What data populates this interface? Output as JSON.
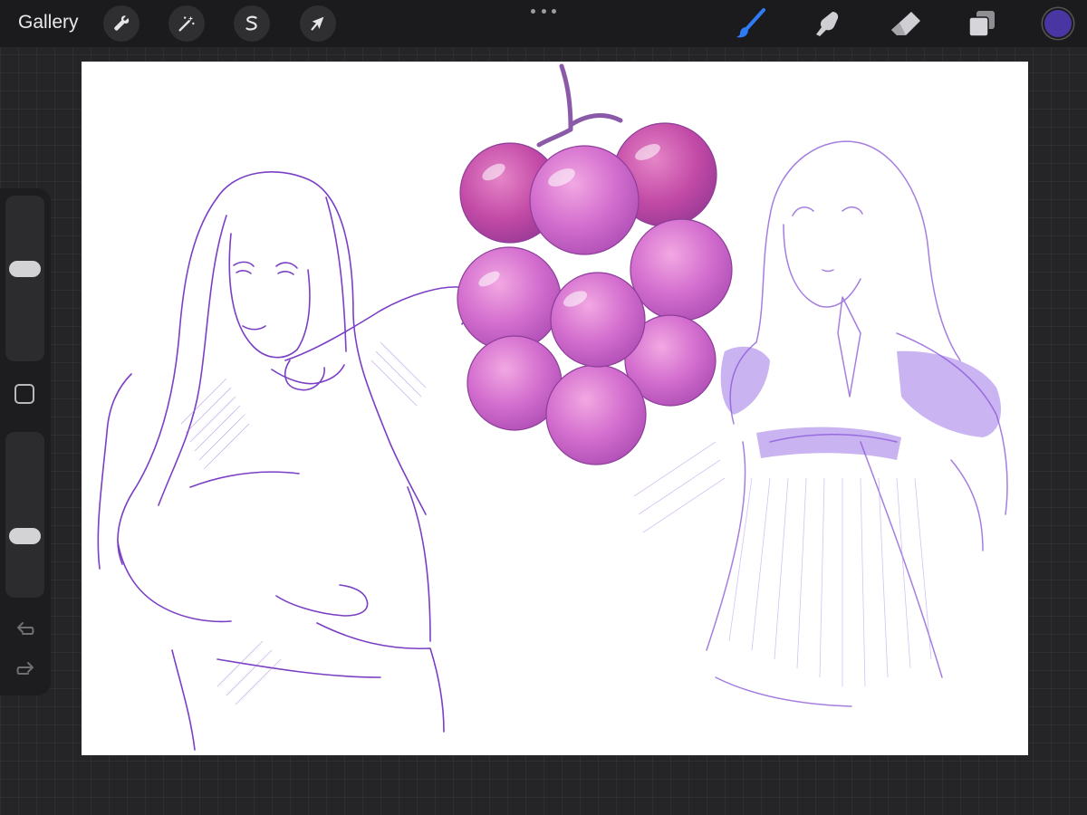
{
  "topbar": {
    "gallery_label": "Gallery",
    "actions": [
      {
        "name": "actions-wrench",
        "icon": "wrench-icon"
      },
      {
        "name": "adjustments",
        "icon": "magic-wand-icon"
      },
      {
        "name": "selection",
        "icon": "selection-s-icon"
      },
      {
        "name": "transform",
        "icon": "arrow-cursor-icon"
      }
    ],
    "more_icon": "ellipsis-icon",
    "tools": [
      {
        "name": "brush",
        "icon": "brush-icon",
        "active": true
      },
      {
        "name": "smudge",
        "icon": "smudge-finger-icon",
        "active": false
      },
      {
        "name": "eraser",
        "icon": "eraser-icon",
        "active": false
      },
      {
        "name": "layers",
        "icon": "layers-icon",
        "active": false
      }
    ],
    "current_color": "#4a36a3"
  },
  "sidebar": {
    "brush_size_level": 0.57,
    "opacity_level": 0.35,
    "modify_icon": "square-modify-icon",
    "undo_icon": "undo-icon",
    "redo_icon": "redo-icon"
  },
  "colors": {
    "accent_blue": "#2f7bf6",
    "line_purple": "#7a3fc4",
    "grape_pink": "#c95bc4",
    "dress_purple": "#8a58e0"
  },
  "canvas": {
    "artwork": "sketch-of-two-girls-and-grape-bunch"
  }
}
